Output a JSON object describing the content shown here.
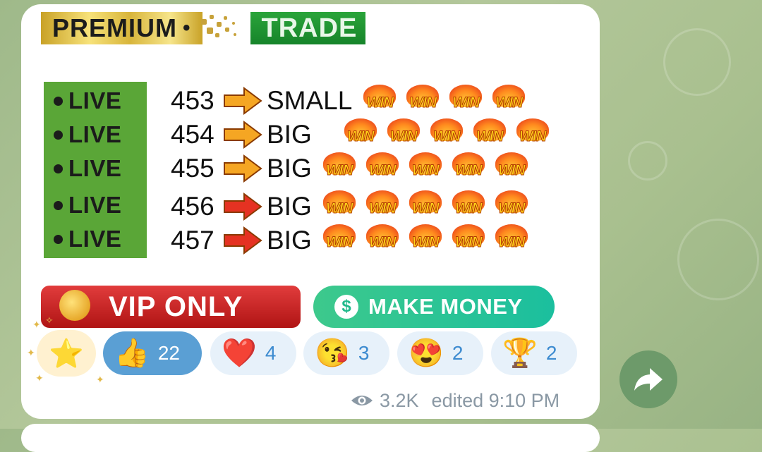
{
  "header": {
    "premium": "PREMIUM",
    "dot": "•",
    "trade": "TRADE"
  },
  "live_label": "LIVE",
  "rows": [
    {
      "period": "453",
      "result": "SMALL",
      "wins": 4
    },
    {
      "period": "454",
      "result": "BIG",
      "wins": 5
    },
    {
      "period": "455",
      "result": "BIG",
      "wins": 5
    },
    {
      "period": "456",
      "result": "BIG",
      "wins": 5
    },
    {
      "period": "457",
      "result": "BIG",
      "wins": 5
    }
  ],
  "win_text": "WIN",
  "arrow_colors": [
    "#f5a623",
    "#f5a623",
    "#f5a623",
    "#e53222",
    "#e53222"
  ],
  "buttons": {
    "vip": "VIP ONLY",
    "money": "MAKE MONEY",
    "money_icon": "$"
  },
  "reactions": [
    {
      "emoji": "⭐",
      "icon": "star-icon"
    },
    {
      "emoji": "👍",
      "count": "22",
      "icon": "thumbs-up-icon"
    },
    {
      "emoji": "❤️",
      "count": "4",
      "icon": "heart-icon"
    },
    {
      "emoji": "😘",
      "count": "3",
      "icon": "kiss-face-icon"
    },
    {
      "emoji": "😍",
      "count": "2",
      "icon": "heart-eyes-icon"
    },
    {
      "emoji": "🏆",
      "count": "2",
      "icon": "trophy-icon"
    }
  ],
  "meta": {
    "views": "3.2K",
    "edited": "edited 9:10 PM"
  },
  "colors": {
    "accent": "#3d8bd0",
    "live_green": "#5aa637",
    "vip_red": "#c51d1d",
    "money_green": "#2cc596"
  }
}
